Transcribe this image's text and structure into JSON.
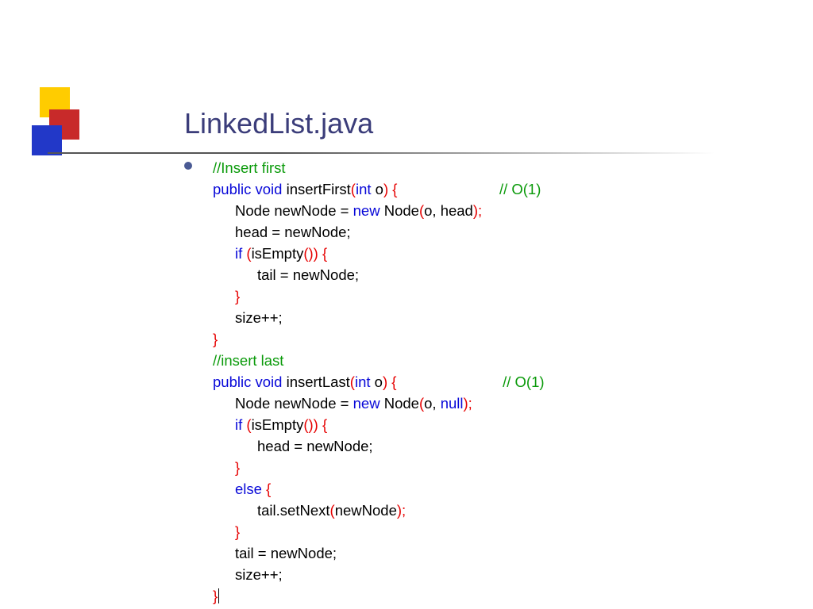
{
  "title": "LinkedList.java",
  "c": {
    "cm_insert_first": "//Insert first",
    "kw_public": "public",
    "kw_void": "void",
    "kw_int": "int",
    "kw_new": "new",
    "kw_if": "if",
    "kw_else": "else",
    "kw_null": "null",
    "id_insertFirst": " insertFirst",
    "id_insertLast": " insertLast",
    "param_o": " o",
    "cm_o1": "// O(1)",
    "stmt_newNode_head_a": "Node newNode = ",
    "stmt_newNode_head_b": " Node",
    "args_o_head": "o, head",
    "stmt_head_assign": "head = newNode;",
    "call_isEmpty": "isEmpty",
    "stmt_tail_assign": "tail = newNode;",
    "stmt_sizepp": "size++;",
    "cm_insert_last": "//insert last",
    "args_o_null_a": "o, ",
    "stmt_setNext_a": "tail.setNext",
    "arg_newNode": "newNode",
    "semicolon": ";",
    "p_open": "(",
    "p_close": ")",
    "b_open_sp": " {",
    "b_close": "}",
    "p_close_p_close": "()) {",
    "p_close_semi": ");",
    "sp": " "
  }
}
